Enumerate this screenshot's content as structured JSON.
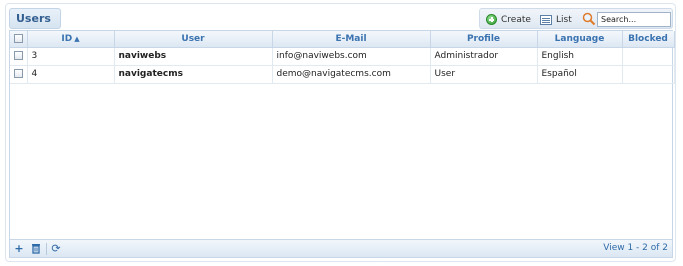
{
  "panel": {
    "title": "Users"
  },
  "toolbar": {
    "create_label": "Create",
    "list_label": "List",
    "search_placeholder": "Search..."
  },
  "grid": {
    "columns": [
      "",
      "ID",
      "User",
      "E-Mail",
      "Profile",
      "Language",
      "Blocked"
    ],
    "rows": [
      {
        "id": "3",
        "user": "naviwebs",
        "email": "info@naviwebs.com",
        "profile": "Administrador",
        "language": "English",
        "blocked": ""
      },
      {
        "id": "4",
        "user": "navigatecms",
        "email": "demo@navigatecms.com",
        "profile": "User",
        "language": "Español",
        "blocked": ""
      }
    ],
    "sort": {
      "column": "ID",
      "direction": "ascending"
    }
  },
  "pager": {
    "info": "View 1 - 2 of 2"
  },
  "colors": {
    "accent": "#3a73b0",
    "header_bg": "#dde8f3",
    "border": "#c7d7e8"
  }
}
